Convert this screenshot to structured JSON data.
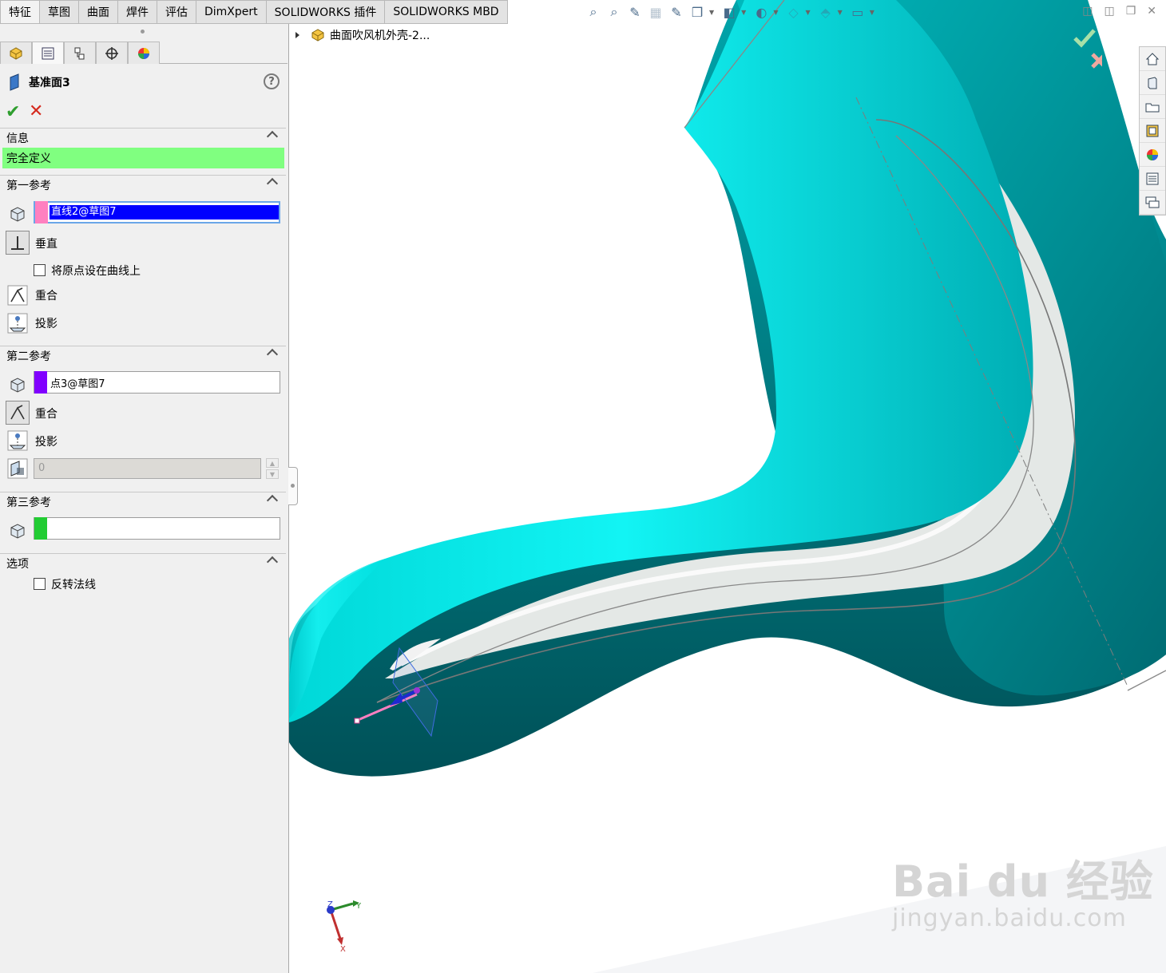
{
  "tabs": [
    "特征",
    "草图",
    "曲面",
    "焊件",
    "评估",
    "DimXpert",
    "SOLIDWORKS 插件",
    "SOLIDWORKS MBD"
  ],
  "property_manager": {
    "title": "基准面3",
    "help": "?",
    "info": {
      "header": "信息",
      "status": "完全定义",
      "status_color": "#80ff80"
    },
    "first_reference": {
      "header": "第一参考",
      "selection": "直线2@草图7",
      "swatch_color": "#ff80c0",
      "perpendicular": "垂直",
      "origin_on_curve": "将原点设在曲线上",
      "coincident": "重合",
      "projection": "投影"
    },
    "second_reference": {
      "header": "第二参考",
      "selection": "点3@草图7",
      "swatch_color": "#8000ff",
      "coincident": "重合",
      "projection": "投影",
      "distance_value": "0"
    },
    "third_reference": {
      "header": "第三参考",
      "selection": "",
      "swatch_color": "#22cc33"
    },
    "options": {
      "header": "选项",
      "flip_normal": "反转法线"
    }
  },
  "viewport": {
    "tree_item": "曲面吹风机外壳-2...",
    "model_color": "#00e6e6",
    "triad": {
      "x": "X",
      "y": "Y",
      "z": "Z"
    },
    "watermark": {
      "brand": "Bai du 经验",
      "url": "jingyan.baidu.com"
    }
  },
  "icons": {
    "hud": [
      "zoom-to-fit-icon",
      "zoom-area-icon",
      "previous-view-icon",
      "section-view-icon",
      "dynamic-annotation-icon",
      "view-orientation-icon",
      "display-style-icon",
      "hide-show-icon",
      "edit-appearance-icon",
      "scene-icon",
      "view-settings-icon"
    ],
    "task_pane": [
      "home-icon",
      "resources-icon",
      "file-explorer-icon",
      "design-library-icon",
      "appearances-icon",
      "custom-properties-icon",
      "forum-icon"
    ]
  }
}
